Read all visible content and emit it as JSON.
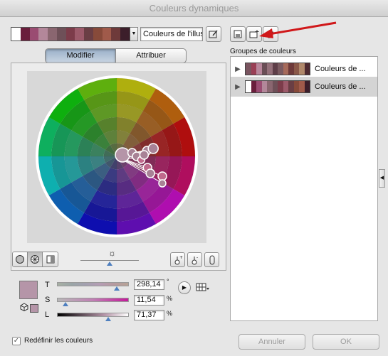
{
  "window": {
    "title": "Couleurs dynamiques"
  },
  "top": {
    "group_name": "Couleurs de l'illustr",
    "swatches": [
      "#ffffff",
      "#6a1e3c",
      "#9a4c72",
      "#b3879a",
      "#8a6670",
      "#6e5058",
      "#7c3c4a",
      "#9c5a6a",
      "#6a3e44",
      "#874a3a",
      "#a05a4a",
      "#6e3a3a",
      "#3c1e2a"
    ]
  },
  "tabs": [
    {
      "label": "Modifier",
      "active": true
    },
    {
      "label": "Attribuer",
      "active": false
    }
  ],
  "colour_sliders": {
    "T": {
      "label": "T",
      "value": "298,14",
      "unit": "°",
      "position": 0.83
    },
    "S": {
      "label": "S",
      "value": "11,54",
      "unit": "%",
      "position": 0.12
    },
    "L": {
      "label": "L",
      "value": "71,37",
      "unit": "%",
      "position": 0.71
    }
  },
  "base_color": "#b595a8",
  "brightness_position": 0.5,
  "groups": {
    "header": "Groupes de couleurs",
    "rows": [
      {
        "name": "Couleurs de ...",
        "selected": false,
        "swatches": [
          "#7a5560",
          "#9a3f55",
          "#b8879c",
          "#6a4e56",
          "#94707a",
          "#5e3e48",
          "#7a5a60",
          "#a66a5a",
          "#6e3a3a",
          "#8a5848",
          "#b0886a",
          "#4e2a30"
        ]
      },
      {
        "name": "Couleurs de ...",
        "selected": true,
        "swatches": [
          "#ffffff",
          "#6a1e3c",
          "#9a4c72",
          "#b3879a",
          "#8a6670",
          "#6e5058",
          "#7c3c4a",
          "#9c5a6a",
          "#6a3e44",
          "#874a3a",
          "#a05a4a",
          "#3c1e2a"
        ]
      }
    ]
  },
  "footer": {
    "recolor_label": "Redéfinir les couleurs",
    "recolor_checked": true,
    "cancel_label": "Annuler",
    "ok_label": "OK"
  },
  "colors": {
    "annotation_arrow": "#d0181a",
    "slider_thumb": "#4e7fbf",
    "selected_row": "#d4d4d4"
  }
}
